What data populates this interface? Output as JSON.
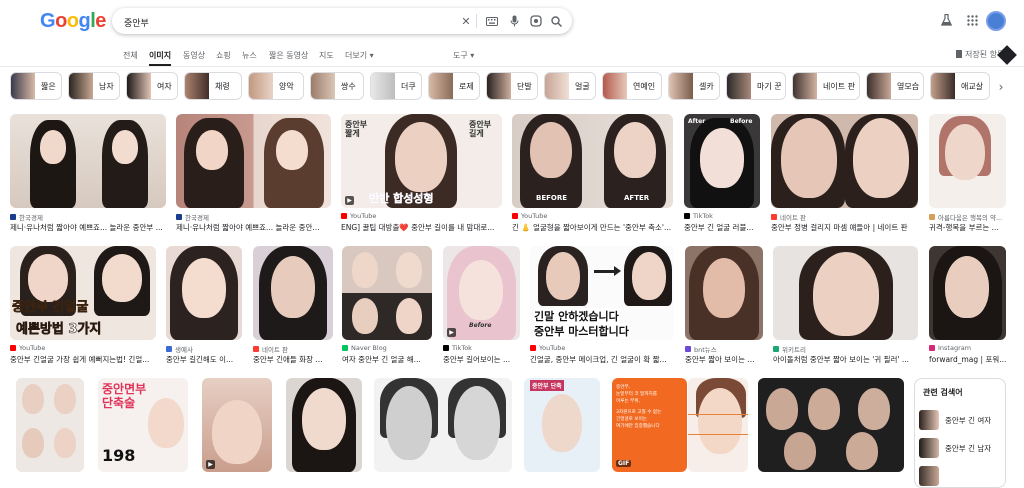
{
  "header": {
    "logo": "Google",
    "query": "중안부",
    "icons": [
      "close-icon",
      "keyboard-icon",
      "mic-icon",
      "lens-icon",
      "search-icon"
    ],
    "right_icons": [
      "labs-icon",
      "apps-icon",
      "account-avatar"
    ]
  },
  "tabs": [
    {
      "label": "전체",
      "active": false
    },
    {
      "label": "이미지",
      "active": true
    },
    {
      "label": "동영상",
      "active": false
    },
    {
      "label": "쇼핑",
      "active": false
    },
    {
      "label": "뉴스",
      "active": false
    },
    {
      "label": "짧은 동영상",
      "active": false
    },
    {
      "label": "지도",
      "active": false
    },
    {
      "label": "더보기 ▾",
      "active": false
    },
    {
      "label": "도구 ▾",
      "active": false
    }
  ],
  "saved_label": "저장된 항목",
  "chips": [
    "짧은",
    "남자",
    "여자",
    "채령",
    "양악",
    "쌍수",
    "더쿠",
    "로제",
    "단발",
    "얼굴",
    "연예인",
    "셀카",
    "마기 꾼",
    "네이트 판",
    "옆모습",
    "애교살"
  ],
  "results": [
    {
      "source": "한국경제",
      "caption": "제니·유나처럼 짧아야 예쁘죠... 놀라운 중안부 ..."
    },
    {
      "source": "한국경제",
      "caption": "제니·유나처럼 짧아야 예쁘죠... 놀라운 중안..."
    },
    {
      "source": "YouTube",
      "caption": "ENG] 꿀팁 대방출❤️ 중안부 길이를 내 맘대로..."
    },
    {
      "source": "YouTube",
      "caption": "긴 👃 얼굴형을 짧아보이게 만드는 '중안부 축소'..."
    },
    {
      "source": "TikTok",
      "caption": "중안부 긴 얼굴 러블..."
    },
    {
      "source": "네이트 판",
      "caption": "중안부 정병 걸리지 마셈 얘들아 | 네이트 판"
    },
    {
      "source": "아름다움은 행복의 약...",
      "caption": "귀격-행복을 부르는 ..."
    },
    {
      "source": "YouTube",
      "caption": "중안부 긴얼굴 가장 쉽게 예뻐지는법! 긴얼..."
    },
    {
      "source": "생예사",
      "caption": "중안부 길긴해도 이..."
    },
    {
      "source": "네이트 판",
      "caption": "중안부 긴애들 화장 ..."
    },
    {
      "source": "Naver Blog",
      "caption": "여자 중안부 긴 얼굴 해..."
    },
    {
      "source": "TikTok",
      "caption": "중안부 길어보이는 ..."
    },
    {
      "source": "YouTube",
      "caption": "긴얼굴, 중안부 메이크업, 긴 얼굴이 확 짧..."
    },
    {
      "source": "bnt뉴스",
      "caption": "중안부 짧아 보이는 ..."
    },
    {
      "source": "위키트리",
      "caption": "아이돌처럼 중안부 짧아 보이는 '귀 필러' ..."
    },
    {
      "source": "Instagram",
      "caption": "forward_mag | 포워..."
    }
  ],
  "overlays": {
    "r1c3_top_left": "중안부\n짧게",
    "r1c3_top_right": "중안부\n길게",
    "r1c3_bottom": "반반 합성성형",
    "r1c4_before": "BEFORE",
    "r1c4_after": "AFTER",
    "r1c5_after": "After",
    "r1c5_before": "Before",
    "r2c1_title": "중안부 긴얼굴",
    "r2c1_sub": "예쁜방법 3가지",
    "r2c5_label": "Before",
    "r2c6_line1": "긴말 안하겠습니다",
    "r2c6_line2": "중안부 마스터합니다",
    "r3c2_title": "중안면부\n단축술",
    "r3c2_num": "198",
    "r3c6_title": "중안부 단축",
    "r3c7_l1": "중안부,",
    "r3c7_l2": "눈밑부터 코 밑까지를",
    "r3c7_l3": "이루는 부위,",
    "r3c7_l4": "3차원으로 고칠 수 없는",
    "r3c7_l5": "긴얼굴로 보이는",
    "r3c7_l6": "여기에만 집중했습니다",
    "gif_badge": "GIF"
  },
  "related": {
    "title": "관련 검색어",
    "items": [
      "중안부 긴 여자",
      "중안부 긴 남자"
    ]
  },
  "colors": {
    "google_blue": "#4285F4",
    "google_red": "#EA4335",
    "google_yellow": "#FBBC05",
    "google_green": "#34A853",
    "youtube": "#ff0000",
    "orange_card": "#f26a21"
  }
}
